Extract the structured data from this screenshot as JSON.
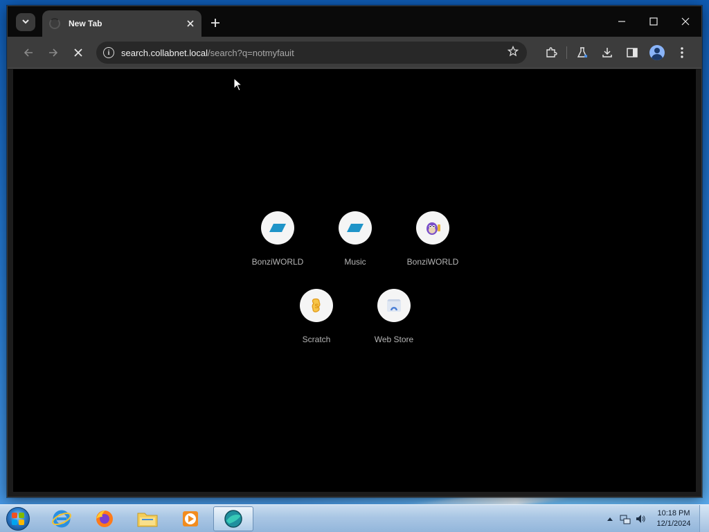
{
  "browser": {
    "tab": {
      "title": "New Tab"
    },
    "address_bar": {
      "host": "search.collabnet.local",
      "path": "/search?q=notmyfauit"
    },
    "state": "loading"
  },
  "shortcuts": [
    {
      "label": "BonziWORLD",
      "icon": "parallelogram-icon",
      "color": "#1f94c8"
    },
    {
      "label": "Music",
      "icon": "parallelogram-icon",
      "color": "#1f94c8"
    },
    {
      "label": "BonziWORLD",
      "icon": "bonzi-monkey-icon",
      "color": "#7a4fc9"
    },
    {
      "label": "Scratch",
      "icon": "scratch-icon",
      "color": "#f5b428"
    },
    {
      "label": "Web Store",
      "icon": "web-store-icon",
      "color": "#4a7fd6"
    }
  ],
  "taskbar": {
    "apps": [
      "internet-explorer-icon",
      "firefox-icon",
      "file-explorer-icon",
      "media-player-icon",
      "browser-icon"
    ],
    "clock": {
      "time": "10:18 PM",
      "date": "12/1/2024"
    }
  },
  "colors": {
    "page_bg": "#000000",
    "toolbar_bg": "#3c3c3c",
    "tabstrip_bg": "#0a0a0a",
    "shortcut_label": "#b5b5b5"
  }
}
